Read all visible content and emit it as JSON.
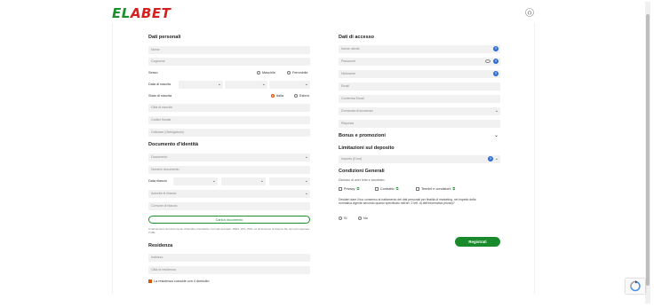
{
  "brand": {
    "logo_part1": "EL",
    "logo_part2": "ABET"
  },
  "personal": {
    "title": "Dati personali",
    "name_placeholder": "Nome",
    "surname_placeholder": "Cognome",
    "sex_label": "Sesso",
    "sex_male": "Maschile",
    "sex_female": "Femminile",
    "birthdate_label": "Data di nascita",
    "birthplace_label": "Stato di nascita",
    "birthplace_italy": "Italia",
    "birthplace_foreign": "Estero",
    "birth_city_placeholder": "Città di nascita",
    "tax_code_placeholder": "Codice fiscale",
    "mobile_placeholder": "Cellulare (Obbligatorio)"
  },
  "document": {
    "title": "Documento d'identità",
    "document_placeholder": "Documento",
    "number_placeholder": "Numero documento",
    "issue_date_label": "Data rilascio",
    "authority_placeholder": "Autorità di rilascio",
    "issue_city_placeholder": "Comune di rilascio",
    "upload_label": "Carica documento",
    "upload_note": "Il caricamento del documento d'identità è facoltativo. Formati accettati: JPEG, JPG, PDF. La dimensione di ciascun file non può superare 2 MB."
  },
  "residence": {
    "title": "Residenza",
    "address_placeholder": "Indirizzo",
    "city_placeholder": "Città di residenza",
    "same_as_domicile": "La residenza coincide con il domicilio"
  },
  "access": {
    "title": "Dati di accesso",
    "username_placeholder": "Nome utente",
    "password_placeholder": "Password",
    "nickname_placeholder": "Nickname",
    "email_placeholder": "Email",
    "confirm_email_placeholder": "Conferma Email",
    "security_question_placeholder": "Domanda di sicurezza",
    "answer_placeholder": "Risposta"
  },
  "bonus": {
    "title": "Bonus e promozioni"
  },
  "deposit": {
    "title": "Limitazioni sul deposito",
    "amount_placeholder": "Importo (Euro)"
  },
  "conditions": {
    "title": "Condizioni Generali",
    "read_label": "Dichiaro di aver letto e accettato:",
    "privacy": "Privacy",
    "contract": "Contratto",
    "terms": "Termini e condizioni",
    "marketing_text": "Desideri dare il tuo consenso al trattamento dei dati personali per finalità di marketing, nel rispetto della normativa vigente secondo quanto specificato nell'art. 2 lett. d) dell'informativa privacy?",
    "yes": "Sì",
    "no": "No"
  },
  "register_label": "Registrati",
  "icons": [
    "home-icon",
    "chevron-down-icon",
    "help-icon",
    "eye-icon",
    "external-link-icon",
    "recaptcha-icon"
  ],
  "colors": {
    "brand_green": "#1a8f2a",
    "brand_red": "#d42020",
    "help_blue": "#2e6dd4"
  }
}
